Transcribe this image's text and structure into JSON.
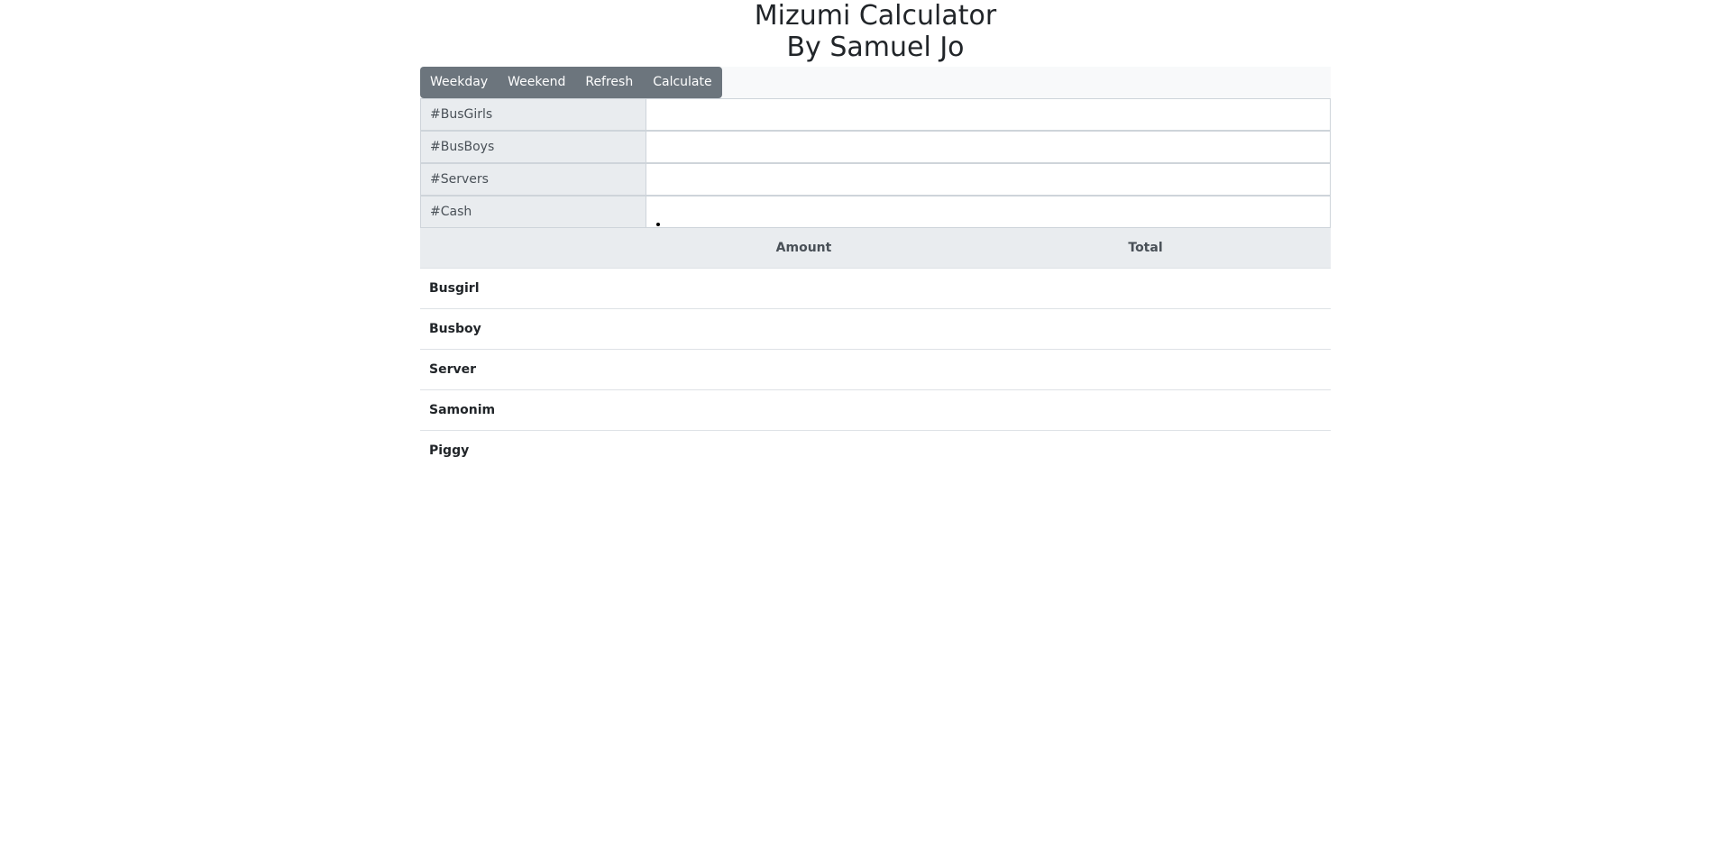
{
  "header": {
    "title_line1": "Mizumi Calculator",
    "title_line2": "By Samuel Jo"
  },
  "toolbar": {
    "buttons": [
      {
        "label": "Weekday"
      },
      {
        "label": "Weekend"
      },
      {
        "label": "Refresh"
      },
      {
        "label": "Calculate"
      }
    ]
  },
  "inputs": [
    {
      "label": "#BusGirls",
      "value": ""
    },
    {
      "label": "#BusBoys",
      "value": ""
    },
    {
      "label": "#Servers",
      "value": ""
    },
    {
      "label": "#Cash",
      "value": ""
    }
  ],
  "table": {
    "columns": [
      "",
      "Amount",
      "Total"
    ],
    "rows": [
      {
        "name": "Busgirl",
        "amount": "",
        "total": ""
      },
      {
        "name": "Busboy",
        "amount": "",
        "total": ""
      },
      {
        "name": "Server",
        "amount": "",
        "total": ""
      },
      {
        "name": "Samonim",
        "amount": "",
        "total": ""
      },
      {
        "name": "Piggy",
        "amount": "",
        "total": ""
      }
    ]
  },
  "colors": {
    "button_bg": "#6c757d",
    "navbar_bg": "#f8f9fa",
    "label_bg": "#e9ecef"
  }
}
